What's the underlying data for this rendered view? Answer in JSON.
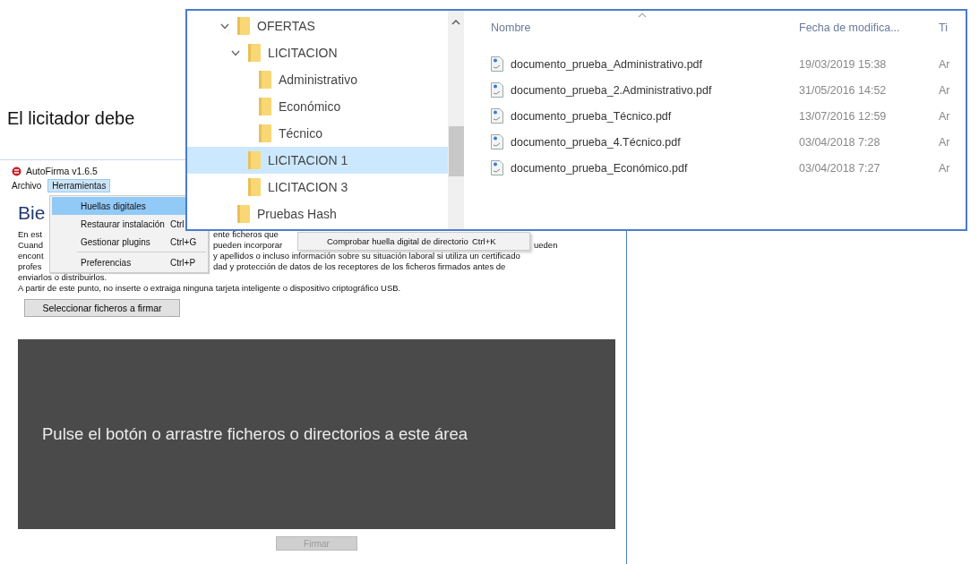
{
  "document": {
    "text": "El licitador debe"
  },
  "autofirma": {
    "title": "AutoFirma v1.6.5",
    "menus": [
      {
        "label": "Archivo",
        "selected": false
      },
      {
        "label": "Herramientas",
        "selected": true
      }
    ],
    "menu_items": [
      {
        "kind": "item",
        "label": "Huellas digitales",
        "selected": true
      },
      {
        "kind": "item",
        "label": "Restaurar instalación",
        "shortcut": "Ctrl",
        "selected": false
      },
      {
        "kind": "item",
        "label": "Gestionar plugins",
        "shortcut": "Ctrl+G",
        "selected": false
      },
      {
        "kind": "separator"
      },
      {
        "kind": "item",
        "label": "Preferencias",
        "shortcut": "Ctrl+P",
        "selected": false
      }
    ],
    "submenu": {
      "label": "Comprobar huella digital de directorio",
      "shortcut": "Ctrl+K"
    },
    "heading": "Bie",
    "body_lines": [
      {
        "left": "En est",
        "middle": "ente ficheros que"
      },
      {
        "left": "Cuand",
        "middle": "pueden incorporar",
        "right": "ueden"
      },
      {
        "left": "encont",
        "middle": "y apellidos o incluso información sobre su situación laboral si utiliza un certificado"
      },
      {
        "left": "profes",
        "middle": "dad y protección de datos de los receptores de los ficheros firmados antes de"
      },
      {
        "full": "enviarlos o distribuirlos."
      },
      {
        "full": "A partir de este punto, no inserte o extraiga ninguna tarjeta inteligente o dispositivo criptográfico USB."
      }
    ],
    "select_button": "Seleccionar ficheros a firmar",
    "drop_area": "Pulse el botón o arrastre ficheros o directorios a este área",
    "sign_button": {
      "label": "Firmar",
      "disabled": true
    }
  },
  "explorer": {
    "tree": [
      {
        "label": "OFERTAS",
        "expanded": true,
        "selected": false,
        "children": [
          {
            "label": "LICITACION",
            "expanded": true,
            "selected": false,
            "children": [
              {
                "label": "Administrativo",
                "selected": false
              },
              {
                "label": "Económico",
                "selected": false
              },
              {
                "label": "Técnico",
                "selected": false
              }
            ]
          },
          {
            "label": "LICITACION 1",
            "selected": true
          },
          {
            "label": "LICITACION 3",
            "selected": false
          }
        ]
      },
      {
        "label": "Pruebas Hash",
        "selected": false
      }
    ],
    "columns": [
      "Nombre",
      "Fecha de modifica...",
      "Ti"
    ],
    "files": [
      {
        "name": "documento_prueba_Administrativo.pdf",
        "date": "19/03/2019 15:38",
        "type": "Ar"
      },
      {
        "name": "documento_prueba_2.Administrativo.pdf",
        "date": "31/05/2016 14:52",
        "type": "Ar"
      },
      {
        "name": "documento_prueba_Técnico.pdf",
        "date": "13/07/2016 12:59",
        "type": "Ar"
      },
      {
        "name": "documento_prueba_4.Técnico.pdf",
        "date": "03/04/2018 7:28",
        "type": "Ar"
      },
      {
        "name": "documento_prueba_Económico.pdf",
        "date": "03/04/2018 7:27",
        "type": "Ar"
      }
    ]
  }
}
